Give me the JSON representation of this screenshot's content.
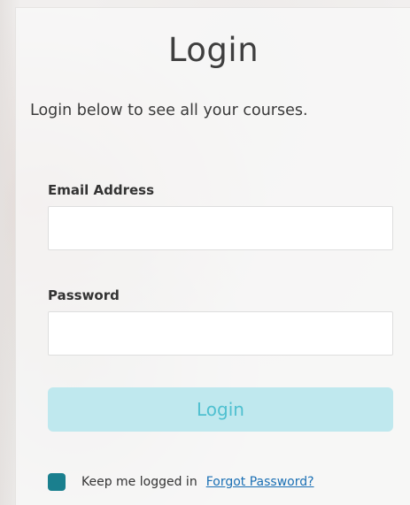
{
  "login_form": {
    "title": "Login",
    "subtitle": "Login below to see all your courses.",
    "email": {
      "label": "Email Address",
      "value": "",
      "placeholder": ""
    },
    "password": {
      "label": "Password",
      "value": "",
      "placeholder": ""
    },
    "submit_label": "Login",
    "remember_me": {
      "label": "Keep me logged in",
      "checked": true
    },
    "forgot_password_label": "Forgot Password?"
  },
  "colors": {
    "accent": "#1a7f8e",
    "button_bg": "#bfe8ee",
    "button_text": "#4fc0d0",
    "link": "#1a6fb4"
  }
}
